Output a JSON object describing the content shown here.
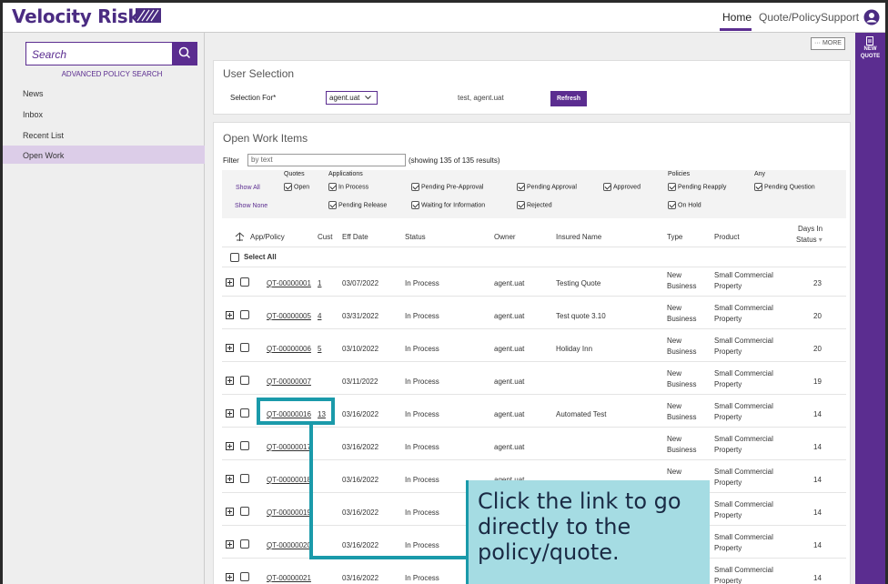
{
  "brand": {
    "name": "Velocity Risk"
  },
  "topnav": {
    "home": "Home",
    "quote_policy": "Quote/Policy",
    "support": "Support"
  },
  "sidebar": {
    "search_placeholder": "Search",
    "advanced_search": "ADVANCED POLICY SEARCH",
    "items": [
      {
        "label": "News"
      },
      {
        "label": "Inbox"
      },
      {
        "label": "Recent List"
      },
      {
        "label": "Open Work"
      }
    ]
  },
  "toolbar": {
    "more_label": "··· MORE"
  },
  "rightbar": {
    "new_quote_line1": "NEW",
    "new_quote_line2": "QUOTE"
  },
  "user_selection": {
    "title": "User Selection",
    "selection_for_label": "Selection For*",
    "selected_value": "agent.uat",
    "user_display": "test, agent.uat",
    "refresh_label": "Refresh"
  },
  "open_work": {
    "title": "Open Work Items",
    "filter_label": "Filter",
    "filter_placeholder": "by text",
    "results_text": "(showing 135 of 135 results)",
    "groups": {
      "quotes": "Quotes",
      "applications": "Applications",
      "policies": "Policies",
      "any": "Any"
    },
    "show_all": "Show All",
    "show_none": "Show None",
    "filters": {
      "open": "Open",
      "in_process": "In Process",
      "pending_pre_approval": "Pending Pre-Approval",
      "pending_approval": "Pending Approval",
      "approved": "Approved",
      "pending_reapply": "Pending Reapply",
      "pending_question": "Pending Question",
      "pending_release": "Pending Release",
      "waiting_for_information": "Waiting for Information",
      "rejected": "Rejected",
      "on_hold": "On Hold"
    },
    "columns": {
      "app_policy": "App/Policy",
      "cust": "Cust",
      "eff_date": "Eff Date",
      "status": "Status",
      "owner": "Owner",
      "insured_name": "Insured Name",
      "type": "Type",
      "product": "Product",
      "days_in_status_1": "Days In",
      "days_in_status_2": "Status"
    },
    "select_all": "Select All",
    "rows": [
      {
        "id": "QT-00000001",
        "cust": "1",
        "eff": "03/07/2022",
        "status": "In Process",
        "owner": "agent.uat",
        "insured": "Testing Quote",
        "type1": "New",
        "type2": "Business",
        "prod1": "Small Commercial",
        "prod2": "Property",
        "days": "23"
      },
      {
        "id": "QT-00000005",
        "cust": "4",
        "eff": "03/31/2022",
        "status": "In Process",
        "owner": "agent.uat",
        "insured": "Test quote 3.10",
        "type1": "New",
        "type2": "Business",
        "prod1": "Small Commercial",
        "prod2": "Property",
        "days": "20"
      },
      {
        "id": "QT-00000006",
        "cust": "5",
        "eff": "03/10/2022",
        "status": "In Process",
        "owner": "agent.uat",
        "insured": "Holiday Inn",
        "type1": "New",
        "type2": "Business",
        "prod1": "Small Commercial",
        "prod2": "Property",
        "days": "20"
      },
      {
        "id": "QT-00000007",
        "cust": "",
        "eff": "03/11/2022",
        "status": "In Process",
        "owner": "agent.uat",
        "insured": "",
        "type1": "New",
        "type2": "Business",
        "prod1": "Small Commercial",
        "prod2": "Property",
        "days": "19"
      },
      {
        "id": "QT-00000016",
        "cust": "13",
        "eff": "03/16/2022",
        "status": "In Process",
        "owner": "agent.uat",
        "insured": "Automated Test",
        "type1": "New",
        "type2": "Business",
        "prod1": "Small Commercial",
        "prod2": "Property",
        "days": "14"
      },
      {
        "id": "QT-00000017",
        "cust": "",
        "eff": "03/16/2022",
        "status": "In Process",
        "owner": "agent.uat",
        "insured": "",
        "type1": "New",
        "type2": "Business",
        "prod1": "Small Commercial",
        "prod2": "Property",
        "days": "14"
      },
      {
        "id": "QT-00000018",
        "cust": "",
        "eff": "03/16/2022",
        "status": "In Process",
        "owner": "agent.uat",
        "insured": "",
        "type1": "New",
        "type2": "",
        "prod1": "Small Commercial",
        "prod2": "Property",
        "days": "14"
      },
      {
        "id": "QT-00000019",
        "cust": "",
        "eff": "03/16/2022",
        "status": "In Process",
        "owner": "",
        "insured": "",
        "type1": "",
        "type2": "",
        "prod1": "Small Commercial",
        "prod2": "Property",
        "days": "14"
      },
      {
        "id": "QT-00000020",
        "cust": "",
        "eff": "03/16/2022",
        "status": "In Process",
        "owner": "",
        "insured": "",
        "type1": "",
        "type2": "",
        "prod1": "Small Commercial",
        "prod2": "Property",
        "days": "14"
      },
      {
        "id": "QT-00000021",
        "cust": "",
        "eff": "03/16/2022",
        "status": "In Process",
        "owner": "",
        "insured": "",
        "type1": "",
        "type2": "",
        "prod1": "Small Commercial",
        "prod2": "Property",
        "days": "14"
      }
    ]
  },
  "callout": {
    "text": "Click the link to go directly to the policy/quote."
  },
  "colors": {
    "brand_purple": "#5b2d90",
    "callout_bg": "#a5dce3",
    "highlight": "#1a9aaa"
  }
}
